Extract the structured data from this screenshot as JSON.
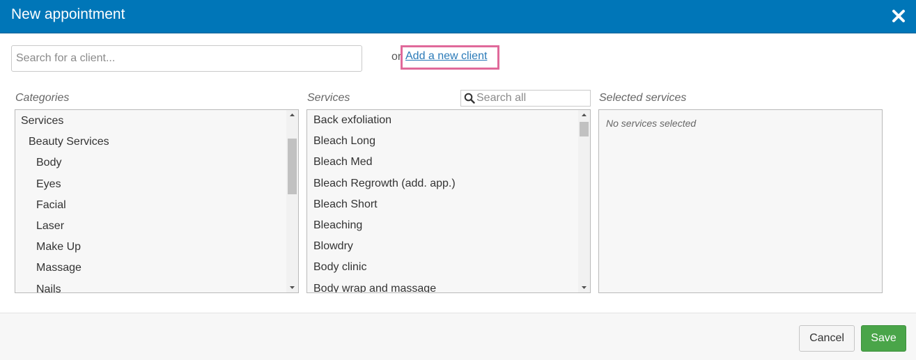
{
  "dialog": {
    "title": "New appointment",
    "accent_color": "#0076b8"
  },
  "client": {
    "search_placeholder": "Search for a client...",
    "or_text": "or",
    "add_link": "Add a new client"
  },
  "categories": {
    "label": "Categories",
    "items": [
      {
        "label": "Services",
        "level": 0
      },
      {
        "label": "Beauty Services",
        "level": 1
      },
      {
        "label": "Body",
        "level": 2
      },
      {
        "label": "Eyes",
        "level": 2
      },
      {
        "label": "Facial",
        "level": 2
      },
      {
        "label": "Laser",
        "level": 2
      },
      {
        "label": "Make Up",
        "level": 2
      },
      {
        "label": "Massage",
        "level": 2
      },
      {
        "label": "Nails",
        "level": 2
      }
    ]
  },
  "services": {
    "label": "Services",
    "search_placeholder": "Search all",
    "items": [
      "Back exfoliation",
      "Bleach Long",
      "Bleach Med",
      "Bleach Regrowth (add. app.)",
      "Bleach Short",
      "Bleaching",
      "Blowdry",
      "Body clinic",
      "Body wrap and massage"
    ]
  },
  "selected": {
    "label": "Selected services",
    "empty_text": "No services selected"
  },
  "footer": {
    "cancel_label": "Cancel",
    "save_label": "Save",
    "save_color": "#4aa549"
  }
}
